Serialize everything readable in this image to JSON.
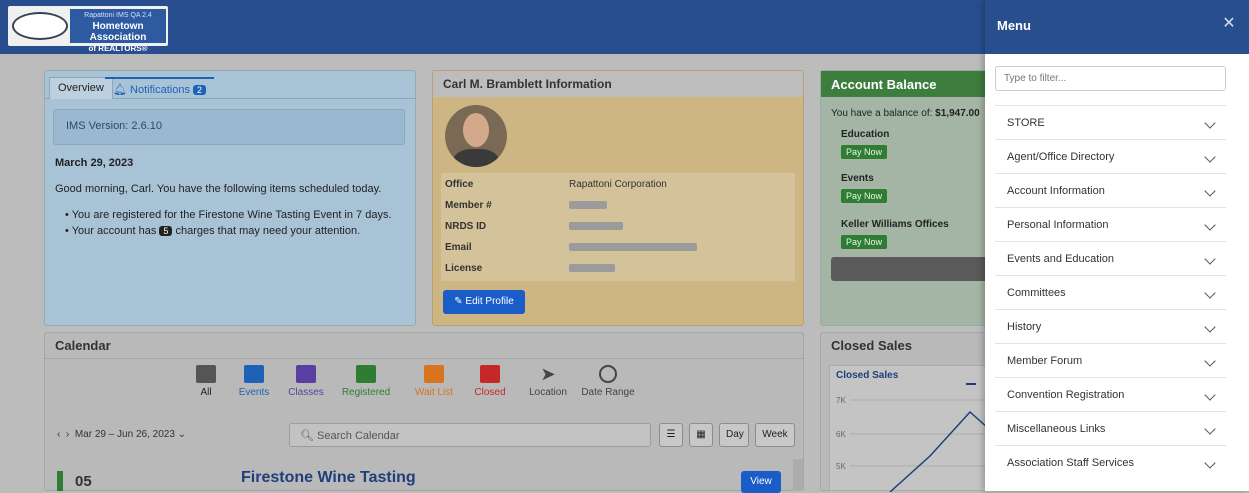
{
  "header": {
    "logo_line1": "Rapattoni IMS QA 2.4",
    "logo_line2": "Hometown Association",
    "logo_line3": "of REALTORS®"
  },
  "overview": {
    "tab_overview": "Overview",
    "tab_notifications": "Notifications",
    "notifications_count": "2",
    "version": "IMS Version: 2.6.10",
    "date": "March 29, 2023",
    "greeting": "Good morning, Carl. You have the following items scheduled today.",
    "bullet1": "You are registered for the Firestone Wine Tasting Event in 7 days.",
    "bullet2_pre": "Your account has",
    "bullet2_count": "5",
    "bullet2_post": "charges that may need your attention."
  },
  "member": {
    "title": "Carl M. Bramblett Information",
    "office_label": "Office",
    "office_value": "Rapattoni Corporation",
    "member_label": "Member #",
    "nrds_label": "NRDS ID",
    "email_label": "Email",
    "license_label": "License",
    "edit_button": "Edit Profile"
  },
  "account": {
    "title": "Account Balance",
    "balance_text": "You have a balance of:",
    "balance_value": "$1,947.00",
    "items": [
      {
        "label": "Education",
        "pay": "Pay Now"
      },
      {
        "label": "Events",
        "pay": "Pay Now"
      },
      {
        "label": "Keller Williams Offices",
        "pay": "Pay Now"
      }
    ]
  },
  "calendar": {
    "title": "Calendar",
    "filters": [
      {
        "label": "All",
        "color": "#555555"
      },
      {
        "label": "Events",
        "color": "#1e62b8"
      },
      {
        "label": "Classes",
        "color": "#5b3fa0"
      },
      {
        "label": "Registered",
        "color": "#2e7d32"
      },
      {
        "label": "Wait List",
        "color": "#d9731e"
      },
      {
        "label": "Closed",
        "color": "#c62828"
      },
      {
        "label": "Location",
        "color": "#555555"
      },
      {
        "label": "Date Range",
        "color": "#555555"
      }
    ],
    "range": "Mar 29 – Jun 26, 2023",
    "search_placeholder": "Search Calendar",
    "day_label": "Day",
    "week_label": "Week",
    "event_day": "05",
    "event_title": "Firestone Wine Tasting",
    "view_button": "View"
  },
  "sales": {
    "title": "Closed Sales",
    "chart_title": "Closed Sales",
    "tick_7k": "7K",
    "tick_6k": "6K",
    "tick_5k": "5K"
  },
  "menu": {
    "title": "Menu",
    "filter_placeholder": "Type to filter...",
    "items": [
      "STORE",
      "Agent/Office Directory",
      "Account Information",
      "Personal Information",
      "Events and Education",
      "Committees",
      "History",
      "Member Forum",
      "Convention Registration",
      "Miscellaneous Links",
      "Association Staff Services"
    ]
  }
}
